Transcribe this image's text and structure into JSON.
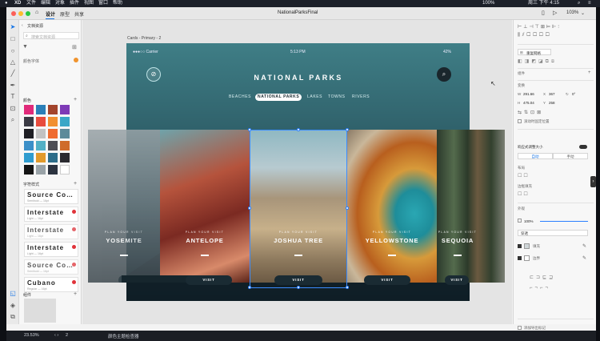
{
  "menubar": {
    "apple": "",
    "items": [
      "XD",
      "文件",
      "编辑",
      "对象",
      "插件",
      "视图",
      "窗口",
      "帮助"
    ],
    "status": {
      "battery": "100%",
      "clock": "周三 下午 4:15"
    }
  },
  "titlebar": {
    "tabs": [
      "设计",
      "原型",
      "共享"
    ],
    "doc_title": "NationalParksFinal",
    "zoom": "103%"
  },
  "left_panel": {
    "header": "文档资源",
    "search_placeholder": "搜索文档资源",
    "groups_label": "颜色字体",
    "colors_label": "颜色",
    "char_styles_label": "字符样式",
    "components_label": "组件",
    "colors": [
      "#e02a7a",
      "#2b7fb8",
      "#a3442c",
      "#7e3ab6",
      "#3a3a44",
      "#e84c3d",
      "#f18f30",
      "#3aa7c7",
      "#1e1e24",
      "#c2c2c2",
      "#ef6b2f",
      "#5c8a9a",
      "#3b8fc8",
      "#52b0c6",
      "#4d4d55",
      "#cf6b2a",
      "#2f9ccf",
      "#e29a2b",
      "#2d6d8a",
      "#2a2a30",
      "#151515",
      "#9aa3a8",
      "#2c3340",
      "#ffffff"
    ],
    "char_styles": [
      {
        "name": "Source Co…",
        "sub": "Semibold — 16pt"
      },
      {
        "name": "Interstate",
        "sub": "Light — 16pt"
      },
      {
        "name": "Interstate",
        "sub": "Light — 16pt"
      },
      {
        "name": "Interstate",
        "sub": "Light — 16pt"
      },
      {
        "name": "Source Co…",
        "sub": "Semibold — 16pt"
      },
      {
        "name": "Cubano",
        "sub": "Regular — 16pt"
      }
    ]
  },
  "canvas": {
    "artboard_label": "Cards - Primary - 2",
    "status": {
      "carrier": "●●●○○ Carrier",
      "time": "5:13 PM",
      "battery": "42%"
    },
    "title": "NATIONAL PARKS",
    "tabs": [
      {
        "label": "BEACHES",
        "selected": false
      },
      {
        "label": "NATIONAL PARKS",
        "selected": true
      },
      {
        "label": "LAKES",
        "selected": false
      },
      {
        "label": "TOWNS",
        "selected": false
      },
      {
        "label": "RIVERS",
        "selected": false
      }
    ],
    "cards": [
      {
        "label": "PLAN YOUR VISIT",
        "name": "YOSEMITE",
        "visit": "VISIT"
      },
      {
        "label": "PLAN YOUR VISIT",
        "name": "ANTELOPE",
        "visit": "VISIT"
      },
      {
        "label": "PLAN YOUR VISIT",
        "name": "JOSHUA TREE",
        "visit": "VISIT"
      },
      {
        "label": "PLAN YOUR VISIT",
        "name": "YELLOWSTONE",
        "visit": "VISIT"
      },
      {
        "label": "PLAN YOUR VISIT",
        "name": "SEQUOIA",
        "visit": "VISIT"
      }
    ]
  },
  "right_panel": {
    "repeat_grid_label": "重复网格",
    "component_label": "组件",
    "transform_label": "变换",
    "w": "291.66",
    "x": "367",
    "rotation": "0°",
    "h": "475.04",
    "y": "258",
    "fix_position_label": "滚动时固定位置",
    "responsive_label": "响应式调整大小",
    "auto_label": "自动",
    "manual_label": "手动",
    "layout_label": "布局",
    "padding_label": "边框填充",
    "appearance_label": "外观",
    "opacity": "100%",
    "blend": "穿透",
    "fill_label": "填充",
    "border_label": "边界",
    "export_label": "添加导出标记"
  },
  "statusbar": {
    "zoom": "23.53%",
    "page": "2",
    "note": "颜色主题检查器"
  }
}
